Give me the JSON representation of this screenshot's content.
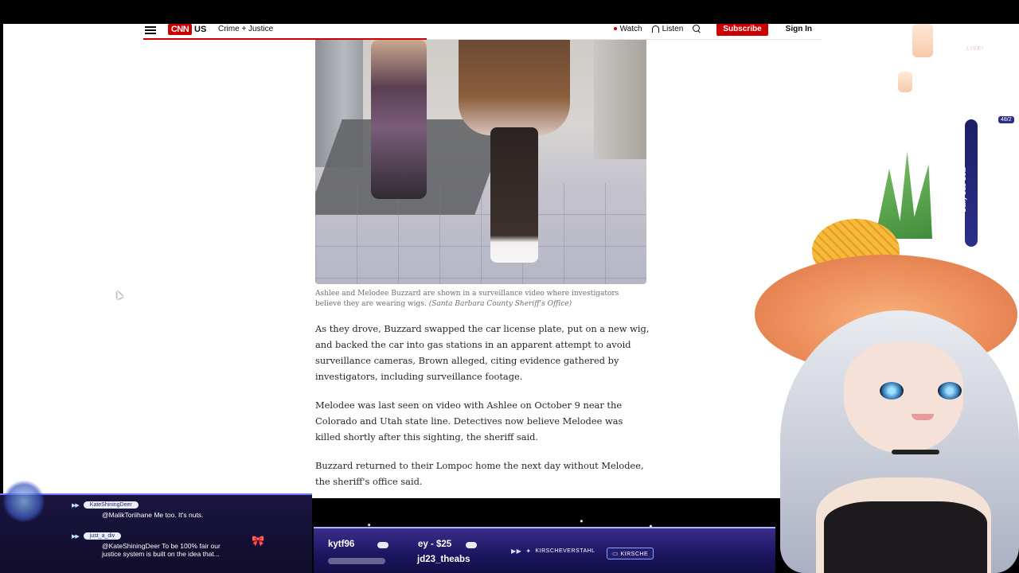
{
  "header": {
    "logo": "CNN",
    "section": "US",
    "subsection": "Crime + Justice",
    "watch": "Watch",
    "listen": "Listen",
    "subscribe": "Subscribe",
    "sign_in": "Sign In"
  },
  "article": {
    "caption": "Ashlee and Melodee Buzzard are shown in a surveillance video where investigators believe they are wearing wigs.",
    "credit": "(Santa Barbara County Sheriff's Office)",
    "paragraphs": [
      "As they drove, Buzzard swapped the car license plate, put on a new wig, and backed the car into gas stations in an apparent attempt to avoid surveillance cameras, Brown alleged, citing evidence gathered by investigators, including surveillance footage.",
      "Melodee was last seen on video with Ashlee on October 9 near the Colorado and Utah state line. Detectives now believe Melodee was killed shortly after this sighting, the sheriff said.",
      "Buzzard returned to their Lompoc home the next day without Melodee, the sheriff's office said."
    ]
  },
  "stream": {
    "chat": [
      {
        "user": "KateShiningDeer",
        "text": "@MalikToriihane Me too. It's nuts."
      },
      {
        "user": "just_a_div",
        "text": "@KateShiningDeer To be 100% fair our justice system is built on the idea that..."
      }
    ],
    "ticker": [
      "kytf96",
      "ey - $25",
      "jd23_theabs"
    ],
    "socials": [
      "KIRSCHEVERSTAHL",
      "KIRSCHE"
    ],
    "goal_label": "Daily Sub Goal",
    "goal_count": "48/2",
    "live_label": "LIVE!",
    "colors": {
      "accent": "#6b7cff",
      "cnn_red": "#cc0000"
    }
  }
}
